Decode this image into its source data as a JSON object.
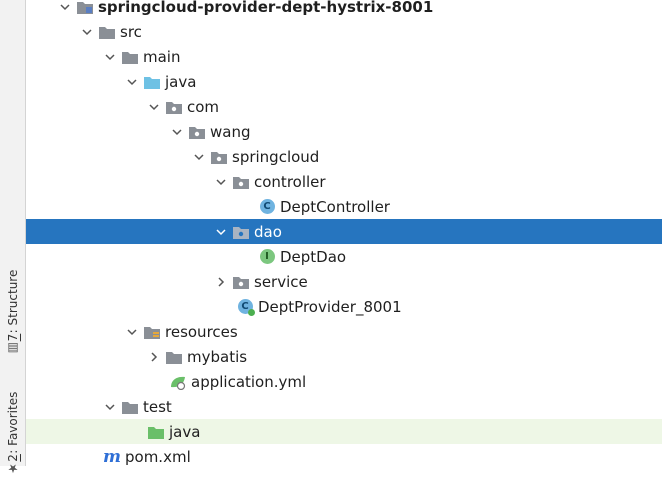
{
  "side_tabs": {
    "structure": {
      "mnemonic": "7",
      "rest": ": Structure",
      "icon": "structure-icon"
    },
    "favorites": {
      "mnemonic": "2",
      "rest": ": Favorites",
      "icon": "star-icon"
    }
  },
  "tree": {
    "root": "springcloud-provider-dept-hystrix-8001",
    "src": "src",
    "main": "main",
    "java": "java",
    "com": "com",
    "wang": "wang",
    "springcloud": "springcloud",
    "controller": "controller",
    "dept_controller": "DeptController",
    "dao": "dao",
    "dept_dao": "DeptDao",
    "service": "service",
    "dept_provider": "DeptProvider_8001",
    "resources": "resources",
    "mybatis": "mybatis",
    "application_yml": "application.yml",
    "test": "test",
    "test_java": "java",
    "pom": "pom.xml"
  },
  "icons": {
    "class_letter": "C",
    "interface_letter": "I",
    "maven_letter": "m"
  },
  "colors": {
    "selection": "#2675bf",
    "test_source_tint": "#eef7e6",
    "folder": "#8a8f96",
    "source_folder": "#6ec1e4",
    "test_folder": "#6abf69"
  }
}
